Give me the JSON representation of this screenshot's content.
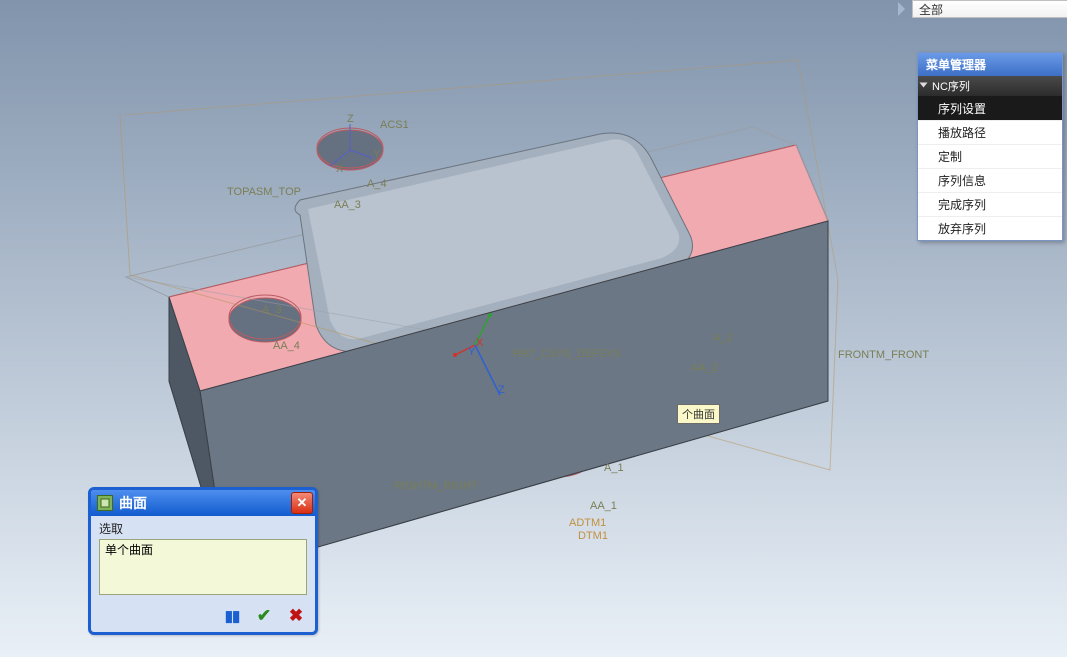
{
  "filter": {
    "label": "全部"
  },
  "menu_manager": {
    "title": "菜单管理器",
    "section": "NC序列",
    "items": [
      {
        "label": "序列设置",
        "selected": true
      },
      {
        "label": "播放路径",
        "selected": false
      },
      {
        "label": "定制",
        "selected": false
      },
      {
        "label": "序列信息",
        "selected": false
      },
      {
        "label": "完成序列",
        "selected": false
      },
      {
        "label": "放弃序列",
        "selected": false
      }
    ]
  },
  "surface_dialog": {
    "title": "曲面",
    "select_label": "选取",
    "text_value": "单个曲面"
  },
  "tooltip": "个曲面",
  "scene": {
    "labels": {
      "acs1": "ACS1",
      "z": "Z",
      "y": "Y",
      "x": "X",
      "a_4": "A_4",
      "aa_3": "AA_3",
      "a_3": "A_3",
      "aa_4": "AA_4",
      "topasm_top": "TOPASM_TOP",
      "frontm_front": "FRONTM_FRONT",
      "rightm_right": "RIGHTM_RIGHT",
      "a_2": "A_2",
      "aa_2": "AA_2",
      "a_1": "A_1",
      "aa_1": "AA_1",
      "adtm1": "ADTM1",
      "dtm1": "DTM1",
      "prt_csys": "PRT_CSYS_DEFSYS",
      "csys_y": "Y",
      "csys_x": "X",
      "csys_z": "Z"
    }
  }
}
